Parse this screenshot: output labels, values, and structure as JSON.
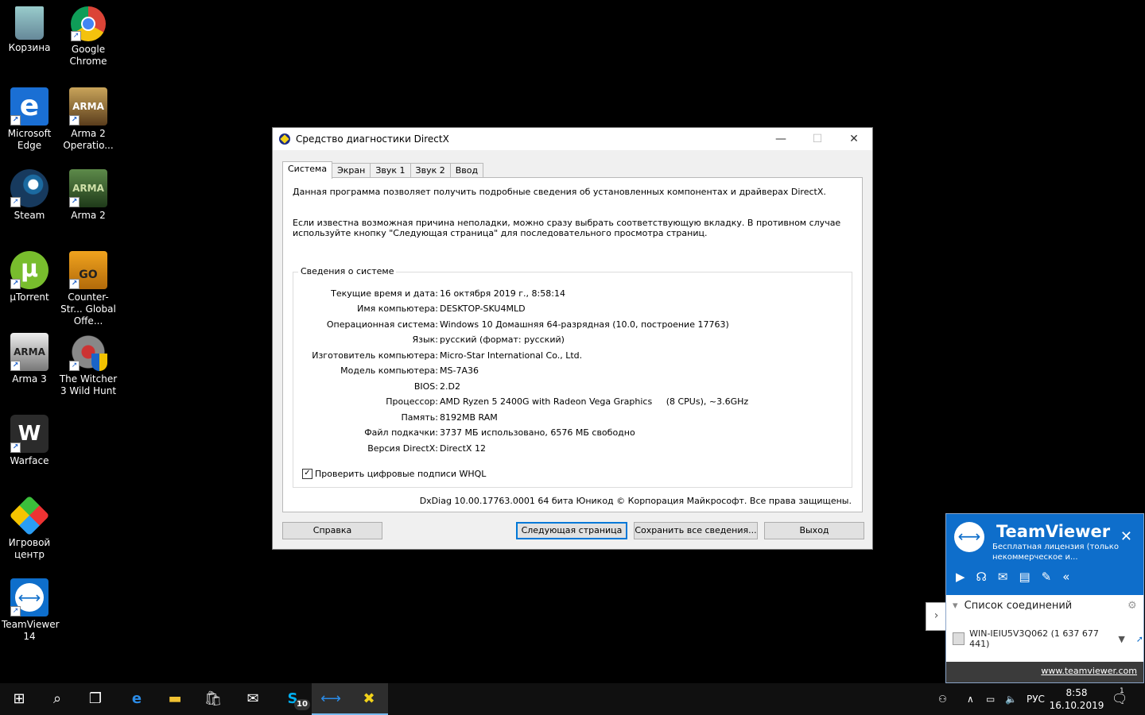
{
  "desktop": {
    "icons": [
      {
        "label": "Корзина"
      },
      {
        "label": "Google Chrome"
      },
      {
        "label": "Microsoft Edge"
      },
      {
        "label": "Arma 2 Operatio..."
      },
      {
        "label": "Steam"
      },
      {
        "label": "Arma 2"
      },
      {
        "label": "µTorrent"
      },
      {
        "label": "Counter-Str... Global Offe..."
      },
      {
        "label": "Arma 3"
      },
      {
        "label": "The Witcher 3 Wild Hunt"
      },
      {
        "label": "Warface"
      },
      {
        "label": "Игровой центр"
      },
      {
        "label": "TeamViewer 14"
      }
    ]
  },
  "dialog": {
    "title": "Средство диагностики DirectX",
    "controls": {
      "minimize": "—",
      "maximize": "☐",
      "close": "✕"
    },
    "tabs": [
      "Система",
      "Экран",
      "Звук 1",
      "Звук 2",
      "Ввод"
    ],
    "intro1": "Данная программа позволяет получить подробные сведения об установленных компонентах и драйверах DirectX.",
    "intro2": "Если известна возможная причина неполадки, можно сразу выбрать соответствующую вкладку. В противном случае используйте кнопку \"Следующая страница\" для последовательного просмотра страниц.",
    "group_title": "Сведения о системе",
    "info": [
      {
        "key": "Текущие время и дата:",
        "value": "16 октября 2019 г., 8:58:14"
      },
      {
        "key": "Имя компьютера:",
        "value": "DESKTOP-SKU4MLD"
      },
      {
        "key": "Операционная система:",
        "value": "Windows 10 Домашняя 64-разрядная (10.0, построение 17763)"
      },
      {
        "key": "Язык:",
        "value": "русский (формат: русский)"
      },
      {
        "key": "Изготовитель компьютера:",
        "value": "Micro-Star International Co., Ltd."
      },
      {
        "key": "Модель компьютера:",
        "value": "MS-7A36"
      },
      {
        "key": "BIOS:",
        "value": "2.D2"
      },
      {
        "key": "Процессор:",
        "value": "AMD Ryzen 5 2400G with Radeon Vega Graphics     (8 CPUs), ~3.6GHz"
      },
      {
        "key": "Память:",
        "value": "8192MB RAM"
      },
      {
        "key": "Файл подкачки:",
        "value": "3737 МБ использовано, 6576 МБ свободно"
      },
      {
        "key": "Версия DirectX:",
        "value": "DirectX 12"
      }
    ],
    "whql_label": "Проверить цифровые подписи WHQL",
    "whql_checked": "✓",
    "copyright": "DxDiag 10.00.17763.0001 64 бита Юникод © Корпорация Майкрософт. Все права защищены.",
    "buttons": {
      "help": "Справка",
      "next": "Следующая страница",
      "save": "Сохранить все сведения...",
      "exit": "Выход"
    }
  },
  "teamviewer": {
    "name": "TeamViewer",
    "license": "Бесплатная лицензия (только некоммерческое и...",
    "close": "✕",
    "list_title": "Список соединений",
    "connection": "WIN-IEIU5V3Q062 (1 637 677 441)",
    "link": "www.teamviewer.com",
    "accent": "#0e6ecb"
  },
  "taskbar": {
    "lang": "РУС",
    "time": "8:58",
    "date": "16.10.2019",
    "skype_badge": "10",
    "notif_count": "1"
  }
}
